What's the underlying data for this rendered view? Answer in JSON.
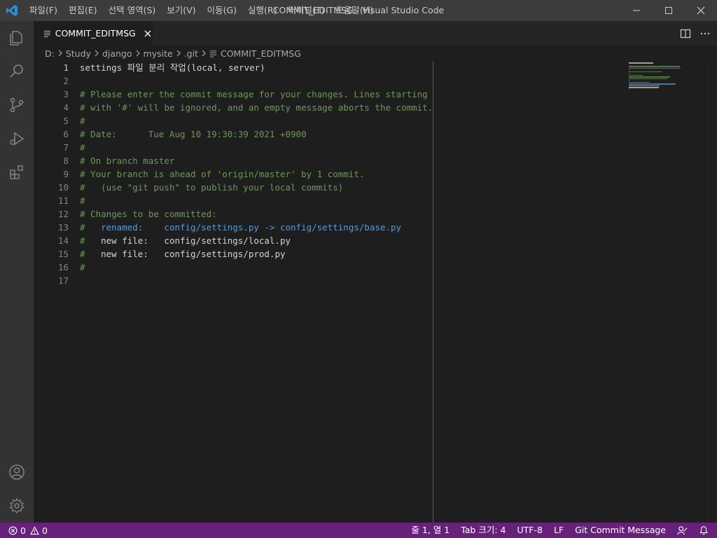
{
  "window": {
    "title": "COMMIT_EDITMSG - Visual Studio Code"
  },
  "menu": [
    {
      "label": "파일(F)"
    },
    {
      "label": "편집(E)"
    },
    {
      "label": "선택 영역(S)"
    },
    {
      "label": "보기(V)"
    },
    {
      "label": "이동(G)"
    },
    {
      "label": "실행(R)"
    },
    {
      "label": "터미널(T)"
    },
    {
      "label": "도움말(H)"
    }
  ],
  "activity_bar": {
    "top_icons": [
      "explorer-icon",
      "search-icon",
      "source-control-icon",
      "run-debug-icon",
      "extensions-icon"
    ],
    "bottom_icons": [
      "account-icon",
      "settings-gear-icon"
    ]
  },
  "tab": {
    "label": "COMMIT_EDITMSG"
  },
  "breadcrumb": {
    "items": [
      "D:",
      "Study",
      "django",
      "mysite",
      ".git",
      "COMMIT_EDITMSG"
    ]
  },
  "editor": {
    "lines": [
      {
        "n": "1",
        "text": "settings 파일 분리 작업(local, server)",
        "kind": "white"
      },
      {
        "n": "2",
        "text": "",
        "kind": "white"
      },
      {
        "n": "3",
        "text": "# Please enter the commit message for your changes. Lines starting",
        "kind": "comment"
      },
      {
        "n": "4",
        "text": "# with '#' will be ignored, and an empty message aborts the commit.",
        "kind": "comment"
      },
      {
        "n": "5",
        "text": "#",
        "kind": "comment"
      },
      {
        "n": "6",
        "text": "# Date:      Tue Aug 10 19:30:39 2021 +0900",
        "kind": "comment"
      },
      {
        "n": "7",
        "text": "#",
        "kind": "comment"
      },
      {
        "n": "8",
        "text": "# On branch master",
        "kind": "comment"
      },
      {
        "n": "9",
        "text": "# Your branch is ahead of 'origin/master' by 1 commit.",
        "kind": "comment"
      },
      {
        "n": "10",
        "text": "#   (use \"git push\" to publish your local commits)",
        "kind": "comment"
      },
      {
        "n": "11",
        "text": "#",
        "kind": "comment"
      },
      {
        "n": "12",
        "text": "# Changes to be committed:",
        "kind": "comment"
      },
      {
        "n": "13",
        "prefix": "#   ",
        "text": "renamed:    config/settings.py -> config/settings/base.py",
        "kind": "blue"
      },
      {
        "n": "14",
        "prefix": "#   ",
        "text": "new file:   config/settings/local.py",
        "kind": "white"
      },
      {
        "n": "15",
        "prefix": "#   ",
        "text": "new file:   config/settings/prod.py",
        "kind": "white"
      },
      {
        "n": "16",
        "text": "#",
        "kind": "comment"
      },
      {
        "n": "17",
        "text": "",
        "kind": "white"
      }
    ]
  },
  "statusbar": {
    "errors": "0",
    "warnings": "0",
    "position": "줄 1, 열 1",
    "tab_size": "Tab 크기: 4",
    "encoding": "UTF-8",
    "eol": "LF",
    "language": "Git Commit Message"
  },
  "colors": {
    "statusbar_bg": "#68217a",
    "comment": "#6a9955",
    "keyword_blue": "#569cd6",
    "editor_bg": "#1e1e1e"
  }
}
